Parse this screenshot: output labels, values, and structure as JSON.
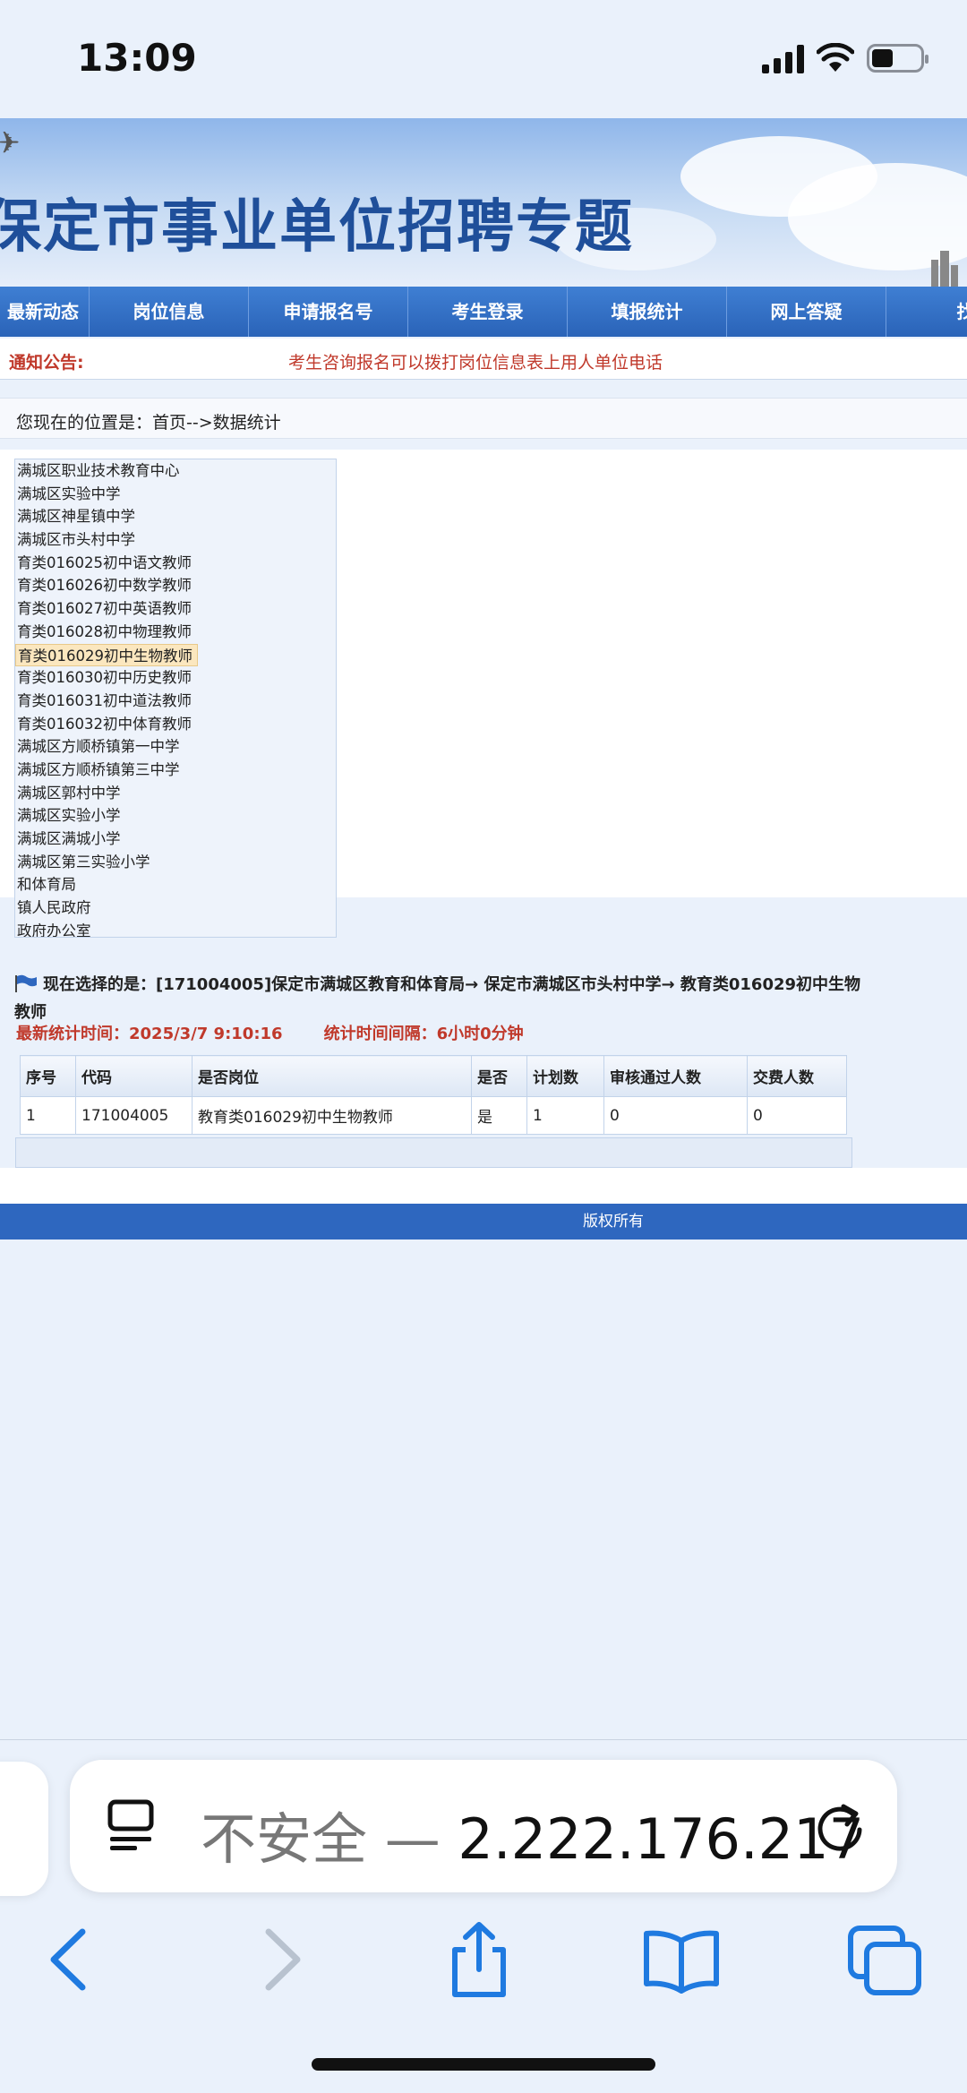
{
  "status": {
    "time": "13:09"
  },
  "banner": {
    "title": "保定市事业单位招聘专题"
  },
  "nav": {
    "items": [
      "最新动态",
      "岗位信息",
      "申请报名号",
      "考生登录",
      "填报统计",
      "网上答疑",
      "找"
    ]
  },
  "notice": {
    "label": "通知公告:",
    "text": "考生咨询报名可以拨打岗位信息表上用人单位电话"
  },
  "location": {
    "text": "您现在的位置是：首页-->数据统计"
  },
  "listbox": {
    "options": [
      "满城区职业技术教育中心",
      "满城区实验中学",
      "满城区神星镇中学",
      "满城区市头村中学",
      "育类016025初中语文教师",
      "育类016026初中数学教师",
      "育类016027初中英语教师",
      "育类016028初中物理教师",
      "育类016029初中生物教师",
      "育类016030初中历史教师",
      "育类016031初中道法教师",
      "育类016032初中体育教师",
      "满城区方顺桥镇第一中学",
      "满城区方顺桥镇第三中学",
      "满城区郭村中学",
      "满城区实验小学",
      "满城区满城小学",
      "满城区第三实验小学",
      "和体育局",
      "镇人民政府",
      "政府办公室"
    ],
    "selected_index": 8
  },
  "selection": {
    "label": "现在选择的是：",
    "path": "[171004005]保定市满城区教育和体育局→ 保定市满城区市头村中学→ 教育类016029初中生物教师"
  },
  "stats": {
    "latest_time_label": "最新统计时间：2025/3/7 9:10:16",
    "interval_label": "统计时间间隔：6小时0分钟"
  },
  "table": {
    "headers": [
      "序号",
      "代码",
      "是否岗位",
      "是否",
      "计划数",
      "审核通过人数",
      "交费人数"
    ],
    "rows": [
      [
        "1",
        "171004005",
        "教育类016029初中生物教师",
        "是",
        "1",
        "0",
        "0"
      ]
    ]
  },
  "footer": {
    "text": "版权所有"
  },
  "browser": {
    "url_prefix": "不安全 — ",
    "url": "2.222.176.217"
  }
}
